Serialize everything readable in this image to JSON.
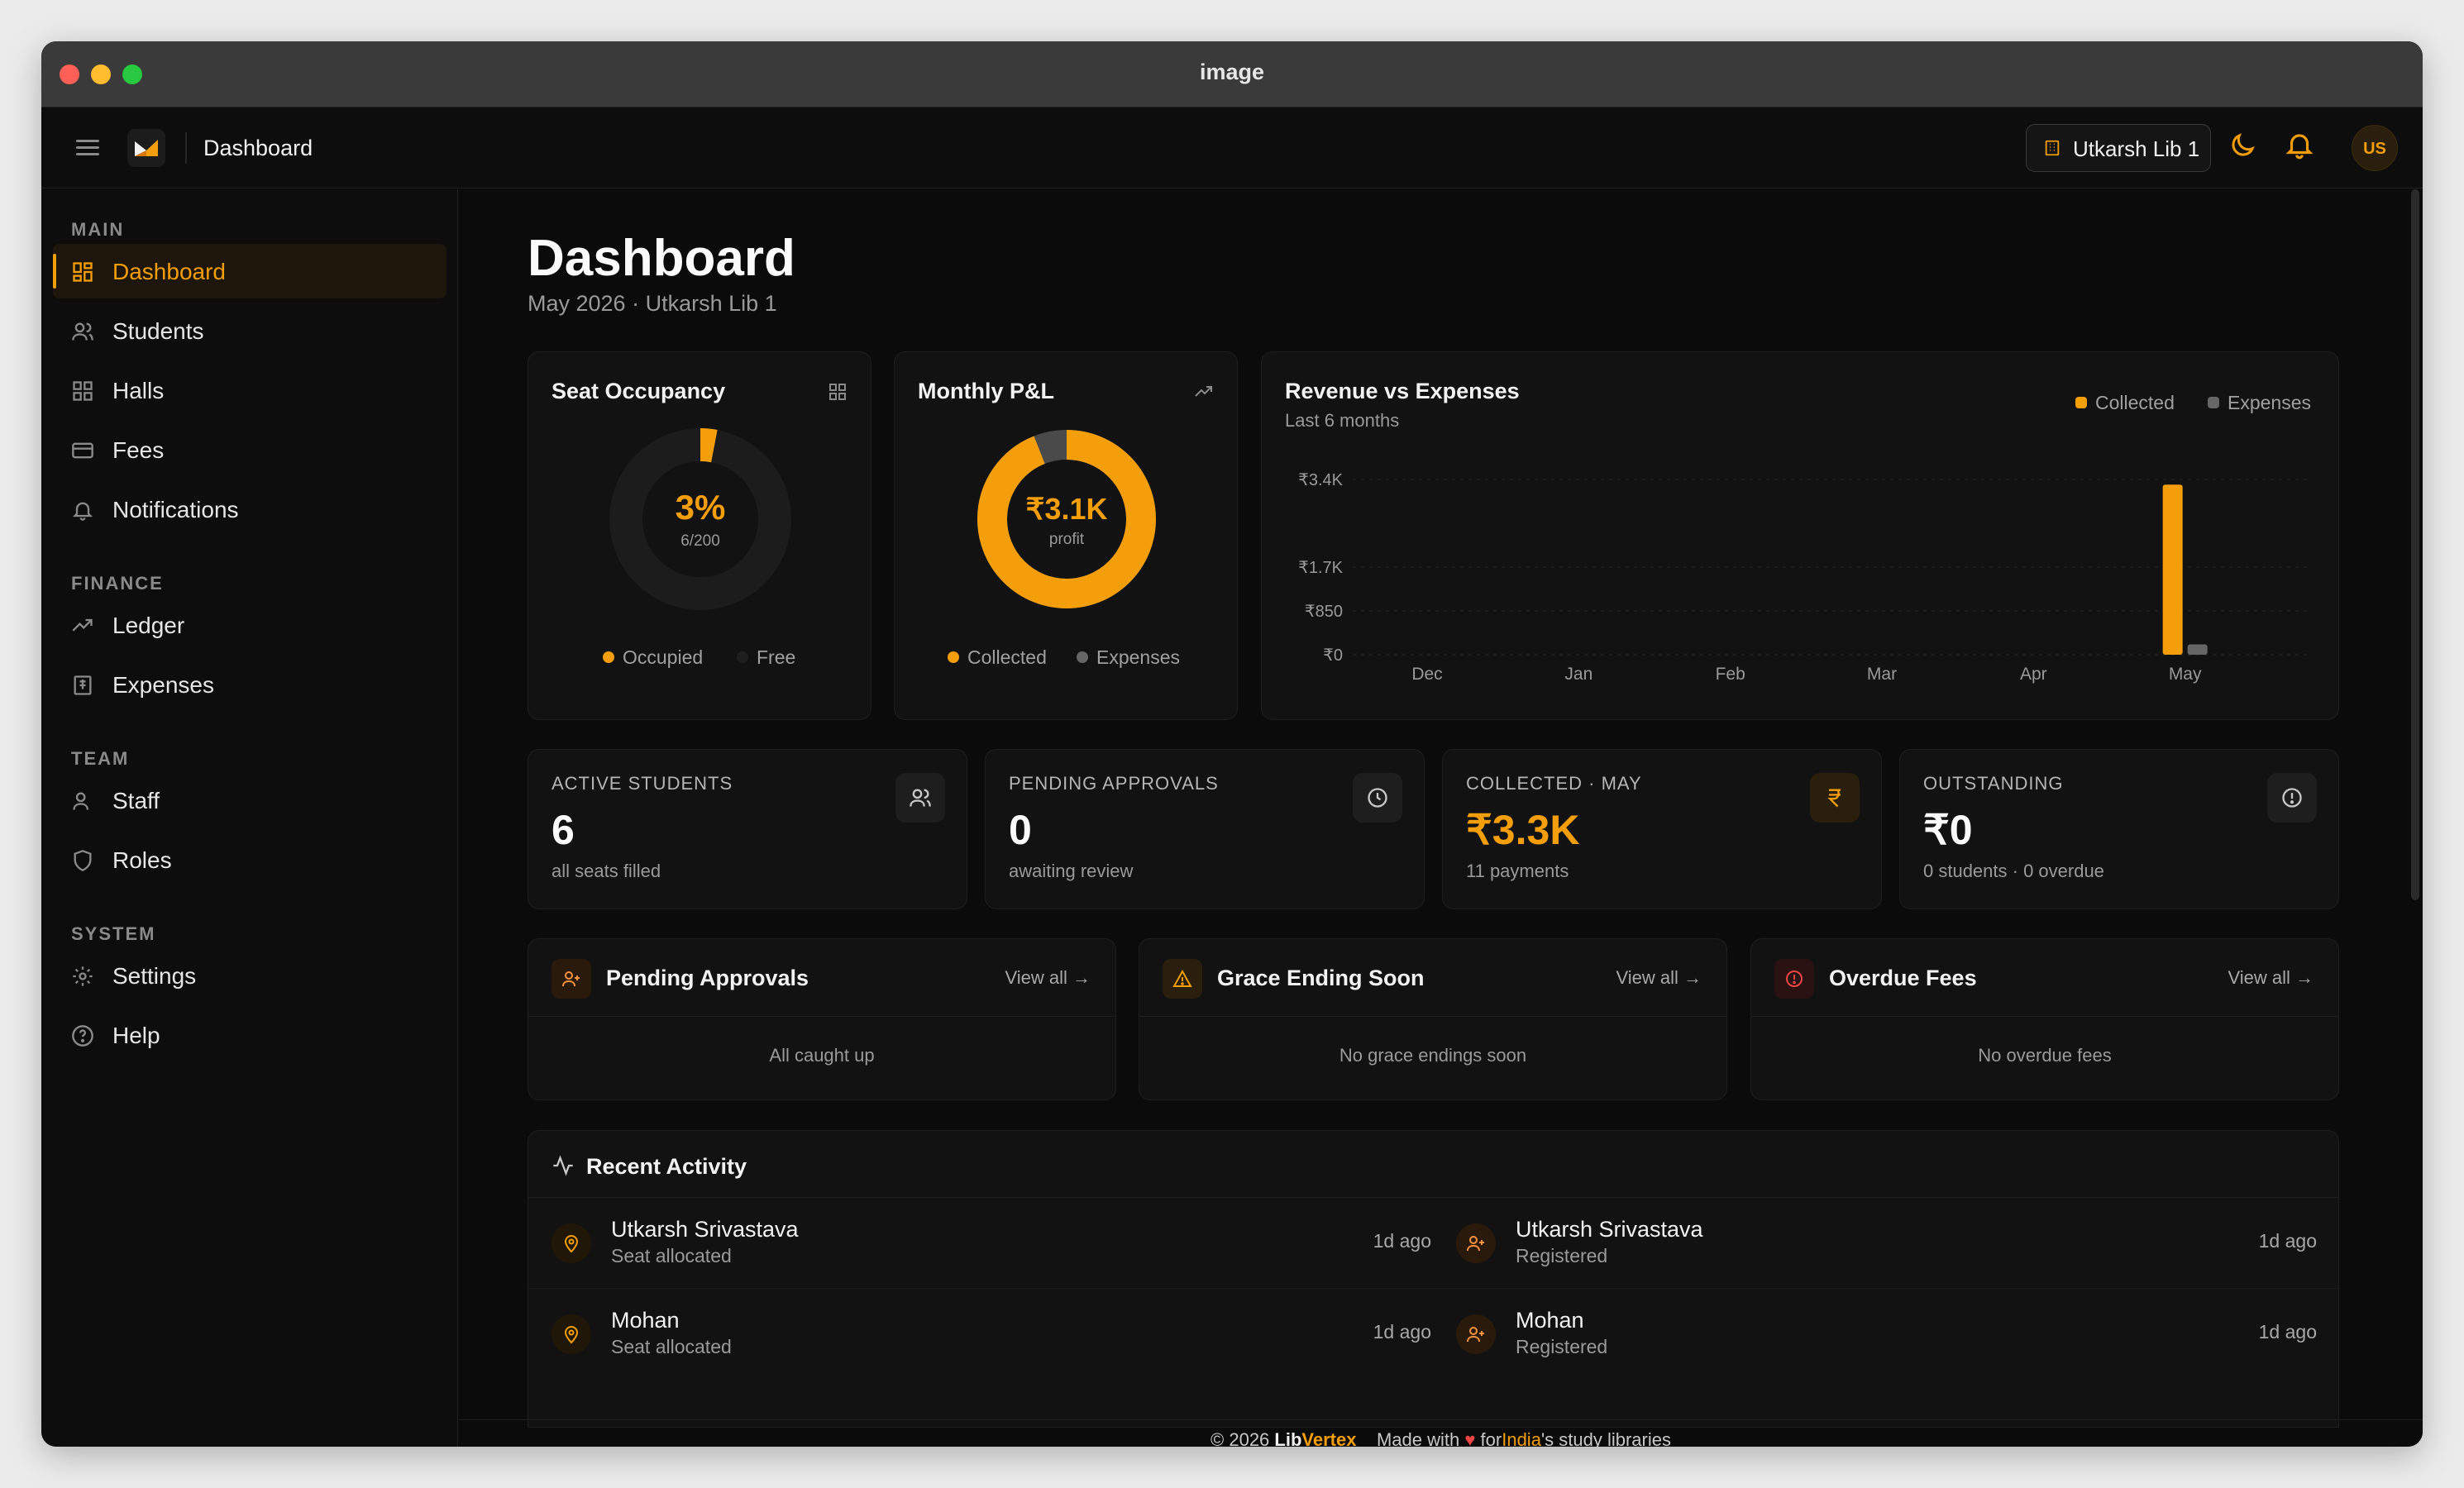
{
  "window": {
    "title": "image"
  },
  "topbar": {
    "title": "Dashboard",
    "library": "Utkarsh Lib 1",
    "avatar": "US"
  },
  "sidebar": {
    "sections": {
      "main": "MAIN",
      "finance": "FINANCE",
      "team": "TEAM",
      "system": "SYSTEM"
    },
    "items": [
      {
        "label": "Dashboard",
        "icon": "dashboard-icon",
        "active": true
      },
      {
        "label": "Students",
        "icon": "users-icon"
      },
      {
        "label": "Halls",
        "icon": "grid-icon"
      },
      {
        "label": "Fees",
        "icon": "card-icon"
      },
      {
        "label": "Notifications",
        "icon": "bell-icon"
      },
      {
        "label": "Ledger",
        "icon": "trend-icon"
      },
      {
        "label": "Expenses",
        "icon": "receipt-icon"
      },
      {
        "label": "Staff",
        "icon": "user-icon"
      },
      {
        "label": "Roles",
        "icon": "shield-icon"
      },
      {
        "label": "Settings",
        "icon": "gear-icon"
      },
      {
        "label": "Help",
        "icon": "help-icon"
      }
    ]
  },
  "page": {
    "title": "Dashboard",
    "subtitle": "May 2026 · Utkarsh Lib 1"
  },
  "occupancy": {
    "title": "Seat Occupancy",
    "percent": "3%",
    "count": "6/200",
    "fraction": 0.03,
    "legend_occupied": "Occupied",
    "legend_free": "Free"
  },
  "pnl": {
    "title": "Monthly P&L",
    "value": "₹3.1K",
    "caption": "profit",
    "collected_fraction": 0.94,
    "legend_collected": "Collected",
    "legend_expenses": "Expenses"
  },
  "revenue": {
    "title": "Revenue vs Expenses",
    "subtitle": "Last 6 months",
    "legend_collected": "Collected",
    "legend_expenses": "Expenses"
  },
  "chart_data": {
    "type": "bar",
    "categories": [
      "Dec",
      "Jan",
      "Feb",
      "Mar",
      "Apr",
      "May"
    ],
    "series": [
      {
        "name": "Collected",
        "values": [
          0,
          0,
          0,
          0,
          0,
          3300
        ]
      },
      {
        "name": "Expenses",
        "values": [
          0,
          0,
          0,
          0,
          0,
          200
        ]
      }
    ],
    "yticks": [
      {
        "v": 3400,
        "label": "₹3.4K"
      },
      {
        "v": 1700,
        "label": "₹1.7K"
      },
      {
        "v": 850,
        "label": "₹850"
      },
      {
        "v": 0,
        "label": "₹0"
      }
    ],
    "ylim": [
      0,
      3400
    ],
    "colors": {
      "Collected": "#f59e0b",
      "Expenses": "#666666"
    }
  },
  "stats": [
    {
      "label": "ACTIVE STUDENTS",
      "value": "6",
      "sub": "all seats filled",
      "icon": "users-icon"
    },
    {
      "label": "PENDING APPROVALS",
      "value": "0",
      "sub": "awaiting review",
      "icon": "clock-icon"
    },
    {
      "label": "COLLECTED · MAY",
      "value": "₹3.3K",
      "sub": "11 payments",
      "icon": "rupee-icon"
    },
    {
      "label": "OUTSTANDING",
      "value": "₹0",
      "sub": "0 students · 0 overdue",
      "icon": "alert-circle-icon"
    }
  ],
  "panels": [
    {
      "title": "Pending Approvals",
      "view": "View all",
      "empty": "All caught up"
    },
    {
      "title": "Grace Ending Soon",
      "view": "View all",
      "empty": "No grace endings soon"
    },
    {
      "title": "Overdue Fees",
      "view": "View all",
      "empty": "No overdue fees"
    }
  ],
  "activity": {
    "title": "Recent Activity",
    "items": [
      {
        "name": "Utkarsh Srivastava",
        "desc": "Seat allocated",
        "time": "1d ago"
      },
      {
        "name": "Utkarsh Srivastava",
        "desc": "Registered",
        "time": "1d ago"
      },
      {
        "name": "Mohan",
        "desc": "Seat allocated",
        "time": "1d ago"
      },
      {
        "name": "Mohan",
        "desc": "Registered",
        "time": "1d ago"
      }
    ]
  },
  "footer": {
    "copy": "© 2026",
    "brand_a": "Lib",
    "brand_b": "Vertex",
    "made": "Made with",
    "for": "for",
    "country": "India",
    "rest": "'s study libraries"
  },
  "colors": {
    "accent": "#f59e0b",
    "background": "#0b0b0b",
    "card": "#121212"
  }
}
